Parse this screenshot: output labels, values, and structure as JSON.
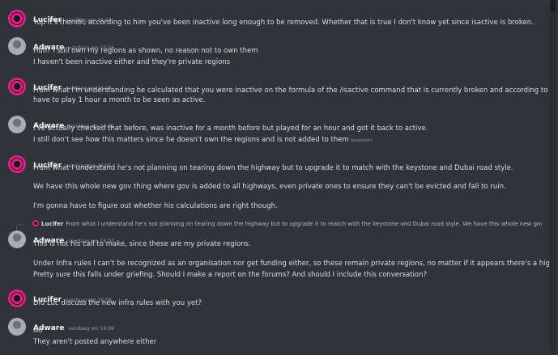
{
  "messages": [
    {
      "author": "Lucifer",
      "time": "vandaag om 15:54",
      "lines": [
        "Yup it's thendil, according to him you've been inactive long enough to be removed. Whether that is true I don't know yet since isactive is broken."
      ]
    },
    {
      "author": "Adware",
      "time": "vandaag om 15:56",
      "lines": [
        "Huh? I still own my regions as shown, no reason not to own them",
        "I haven't been inactive either and they're private regions"
      ]
    },
    {
      "author": "Lucifer",
      "time": "vandaag om 16:00",
      "lines": [
        "From what I'm understanding he calculated that you were inactive on the formula of the /isactive command that is currently broken and according to that formula you",
        "have to play 1 hour a month to be seen as active."
      ]
    },
    {
      "author": "Adware",
      "time": "vandaag om 16:01",
      "lines": [
        "I've actually checked that before, was inactive for a month before but played for an hour and got it back to active.",
        "I still don't see how this matters since he doesn't own the regions and is not added to them"
      ],
      "edited": "(bewerkt)"
    },
    {
      "author": "Lucifer",
      "time": "vandaag om 16:05",
      "lines": [
        "From what I understand he's not planning on tearing down the highway but to upgrade it to match with the keystone and Dubai road style.",
        "We have this whole new gov thing where gov is added to all highways, even private ones to ensure they can't be evicted and fall to ruin.",
        "I'm gonna have to figure out whether his calculations are right though."
      ]
    },
    {
      "author": "Adware",
      "time": "vandaag om 16:07",
      "reply": {
        "author": "Lucifer",
        "text": "From what I understand he's not planning on tearing down the highway but to upgrade it to match with the keystone and Dubai road style. We have this whole new gov thing where gov is added to all highways, even private ones to ensure they can't be evicted and fall to ruin."
      },
      "lines": [
        "This is not his call to make, since these are my private regions.",
        "Under Infra rules I can't be recognized as an organisation nor get funding either, so these remain private regions, no matter if it appears there's a highway on it or not",
        "Pretty sure this falls under griefing. Should I make a report on the forums? And should I include this conversation?"
      ]
    },
    {
      "author": "Lucifer",
      "time": "vandaag om 16:09",
      "lines": [
        "Did Luc discuss the new infra rules with you yet?"
      ]
    },
    {
      "author": "Adware",
      "time": "vandaag om 16:09",
      "lines": [
        "No",
        "They aren't posted anywhere either"
      ]
    }
  ]
}
